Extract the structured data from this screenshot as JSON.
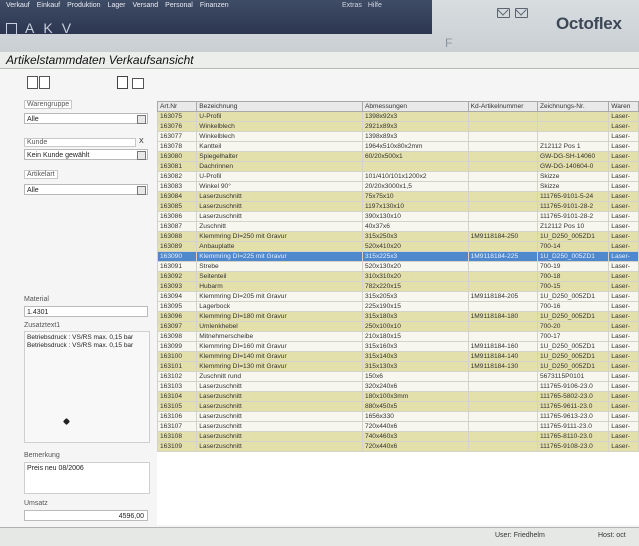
{
  "menu": {
    "items": [
      "Verkauf",
      "Einkauf",
      "Produktion",
      "Lager",
      "Versand",
      "Personal",
      "Finanzen"
    ],
    "right": [
      "Extras",
      "Hilfe"
    ]
  },
  "nav_letters": [
    "A",
    "K",
    "V"
  ],
  "nav_f": "F",
  "logo": "Octoflex",
  "page_title": "Artikelstammdaten Verkaufsansicht",
  "filters": {
    "warengruppe": {
      "label": "Warengruppe",
      "value": "Alle"
    },
    "kunde": {
      "label": "Kunde",
      "value": "Kein Kunde gewählt",
      "clear": "X"
    },
    "artikelart": {
      "label": "Artikelart",
      "value": "Alle"
    }
  },
  "details": {
    "material_label": "Material",
    "material_value": "1.4301",
    "zusatztext_label": "Zusatztext1",
    "zusatztext_lines": [
      "Betriebsdruck : VS/RS max. 0,15 bar",
      "Betriebsdruck : VS/RS max. 0,15 bar"
    ],
    "bemerkung_label": "Bemerkung",
    "bemerkung_value": "Preis neu 08/2006",
    "umsatz_label": "Umsatz",
    "umsatz_value": "4596,00"
  },
  "table": {
    "columns": [
      "Art.Nr",
      "Bezeichnung",
      "Abmessungen",
      "Kd-Artikelnummer",
      "Zeichnungs-Nr.",
      "Waren"
    ],
    "rows": [
      [
        "163075",
        "U-Profil",
        "1398x92x3",
        "",
        "",
        "Laser-"
      ],
      [
        "163076",
        "Winkelblech",
        "2921x89x3",
        "",
        "",
        "Laser-"
      ],
      [
        "163077",
        "Winkelblech",
        "1398x89x3",
        "",
        "",
        "Laser-"
      ],
      [
        "163078",
        "Kantteil",
        "1964x510x80x2mm",
        "",
        "Z12112 Pos 1",
        "Laser-"
      ],
      [
        "163080",
        "Spiegelhalter",
        "60/20x500x1",
        "",
        "GW-DG-SH-14060",
        "Laser-"
      ],
      [
        "163081",
        "Dachrinnen",
        "",
        "",
        "GW-DG-140604-0",
        "Laser-"
      ],
      [
        "163082",
        "U-Profil",
        "101/410/101x1200x2",
        "",
        "Skizze",
        "Laser-"
      ],
      [
        "163083",
        "Winkel 90°",
        "20/20x3000x1,5",
        "",
        "Skizze",
        "Laser-"
      ],
      [
        "163084",
        "Laserzuschnitt",
        "75x75x10",
        "",
        "111765-9101-5-24",
        "Laser-"
      ],
      [
        "163085",
        "Laserzuschnitt",
        "1197x130x10",
        "",
        "111765-9101-28-2",
        "Laser-"
      ],
      [
        "163086",
        "Laserzuschnitt",
        "390x130x10",
        "",
        "111765-9101-28-2",
        "Laser-"
      ],
      [
        "163087",
        "Zuschnitt",
        "40x37x6",
        "",
        "Z12112 Pos 10",
        "Laser-"
      ],
      [
        "163088",
        "Klemmring DI=250 mit Gravur",
        "315x250x3",
        "1M9118184-250",
        "1U_D250_005ZD1",
        "Laser-"
      ],
      [
        "163089",
        "Anbauplatte",
        "520x410x20",
        "",
        "700-14",
        "Laser-"
      ],
      [
        "163090",
        "Klemmring DI=225 mit Gravur",
        "315x225x3",
        "1M9118184-225",
        "1U_D250_005ZD1",
        "Laser-"
      ],
      [
        "163091",
        "Strebe",
        "520x130x20",
        "",
        "700-19",
        "Laser-"
      ],
      [
        "163092",
        "Seitenteil",
        "310x310x20",
        "",
        "700-18",
        "Laser-"
      ],
      [
        "163093",
        "Hubarm",
        "782x220x15",
        "",
        "700-15",
        "Laser-"
      ],
      [
        "163094",
        "Klemmring DI=205 mit Gravur",
        "315x205x3",
        "1M9118184-205",
        "1U_D250_005ZD1",
        "Laser-"
      ],
      [
        "163095",
        "Lagerbock",
        "225x190x15",
        "",
        "700-16",
        "Laser-"
      ],
      [
        "163096",
        "Klemmring DI=180 mit Gravur",
        "315x180x3",
        "1M9118184-180",
        "1U_D250_005ZD1",
        "Laser-"
      ],
      [
        "163097",
        "Umlenkhebel",
        "250x100x10",
        "",
        "700-20",
        "Laser-"
      ],
      [
        "163098",
        "Mitnehmerscheibe",
        "210x180x15",
        "",
        "700-17",
        "Laser-"
      ],
      [
        "163099",
        "Klemmring DI=160 mit Gravur",
        "315x160x3",
        "1M9118184-160",
        "1U_D250_005ZD1",
        "Laser-"
      ],
      [
        "163100",
        "Klemmring DI=140 mit Gravur",
        "315x140x3",
        "1M9118184-140",
        "1U_D250_005ZD1",
        "Laser-"
      ],
      [
        "163101",
        "Klemmring DI=130 mit Gravur",
        "315x130x3",
        "1M9118184-130",
        "1U_D250_005ZD1",
        "Laser-"
      ],
      [
        "163102",
        "Zuschnitt rund",
        "150x6",
        "",
        "5673115P0101",
        "Laser-"
      ],
      [
        "163103",
        "Laserzuschnitt",
        "320x240x6",
        "",
        "111765-9106-23.0",
        "Laser-"
      ],
      [
        "163104",
        "Laserzuschnitt",
        "180x100x3mm",
        "",
        "111765-5802-23.0",
        "Laser-"
      ],
      [
        "163105",
        "Laserzuschnitt",
        "880x450x5",
        "",
        "111765-9611-23.0",
        "Laser-"
      ],
      [
        "163106",
        "Laserzuschnitt",
        "1656x330",
        "",
        "111765-9613-23.0",
        "Laser-"
      ],
      [
        "163107",
        "Laserzuschnitt",
        "720x440x6",
        "",
        "111765-9111-23.0",
        "Laser-"
      ],
      [
        "163108",
        "Laserzuschnitt",
        "740x460x3",
        "",
        "111765-8110-23.0",
        "Laser-"
      ],
      [
        "163109",
        "Laserzuschnitt",
        "720x440x6",
        "",
        "111765-9108-23.0",
        "Laser-"
      ]
    ],
    "selected_index": 14
  },
  "status": {
    "user_label": "User:",
    "user_value": "Friedhelm",
    "host_label": "Host:",
    "host_value": "oct"
  },
  "colors": {
    "row_yellow": "#e3e0ab",
    "row_white": "#f7f7ef",
    "row_selected": "#4f88cc",
    "menu_bg": "#2c3650"
  }
}
